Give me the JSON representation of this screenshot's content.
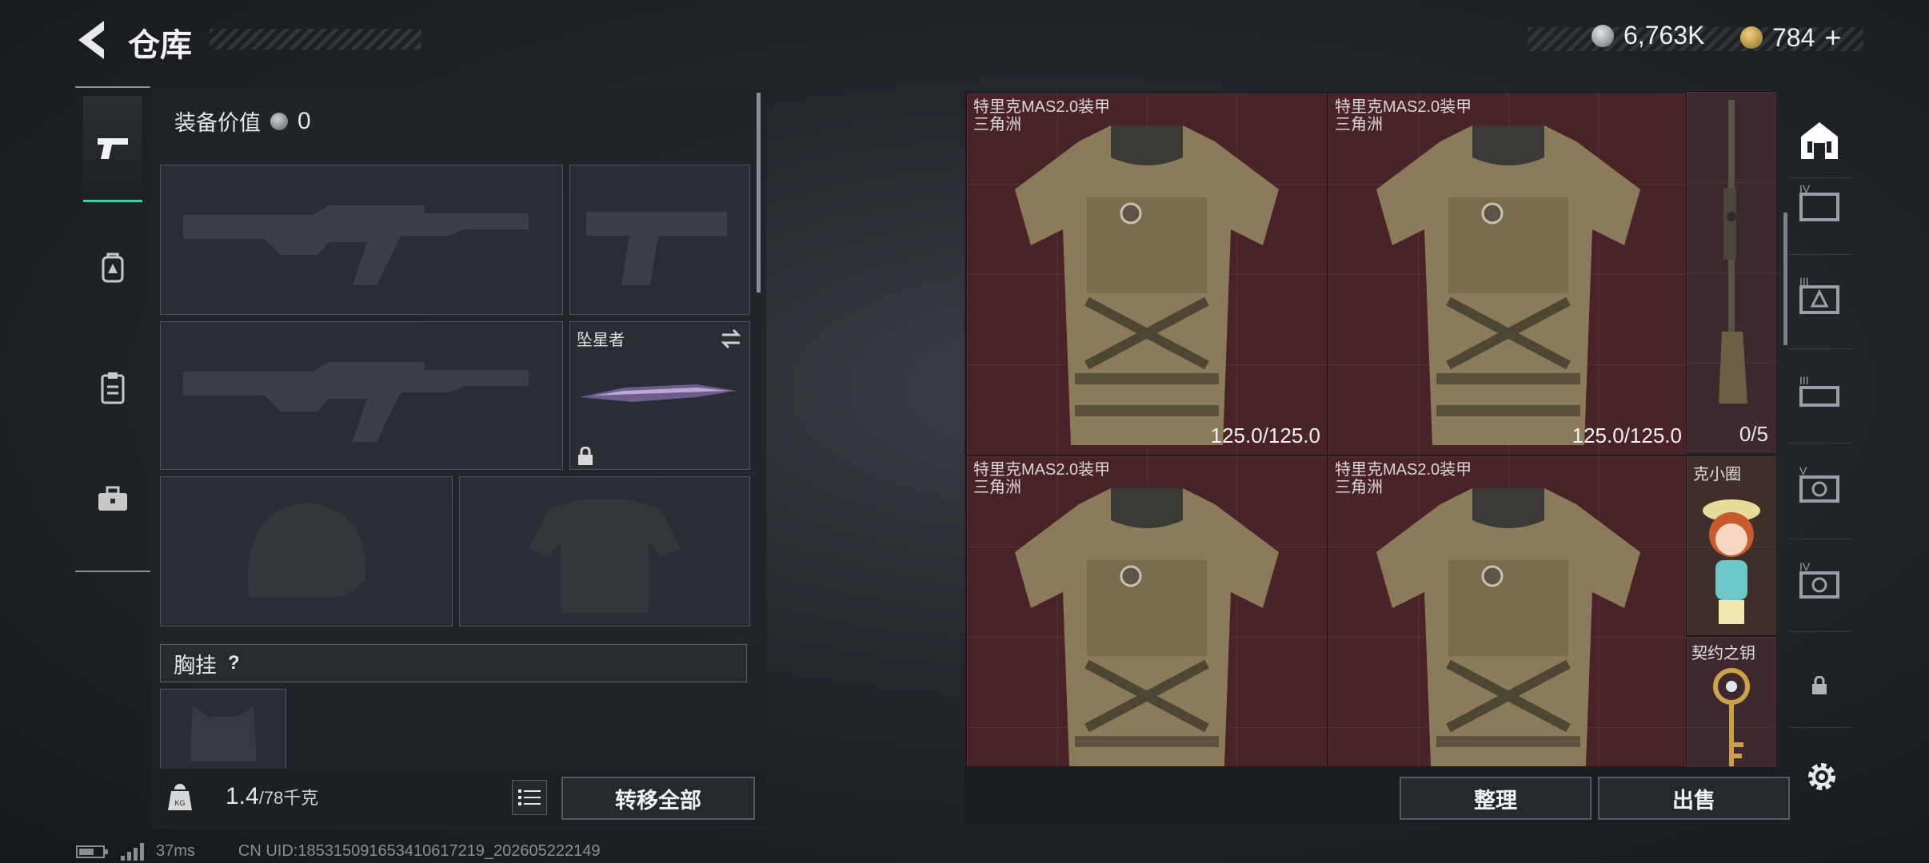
{
  "header": {
    "title": "仓库",
    "currency_1": {
      "value": "6,763K",
      "icon": "silver-coin-icon"
    },
    "currency_2": {
      "value": "784",
      "plus": "+",
      "icon": "gold-triangle-coin-icon"
    }
  },
  "left_tabs": [
    {
      "name": "weapon-tab",
      "icon": "pistol-icon",
      "active": true
    },
    {
      "name": "gear-tab",
      "icon": "backpack-icon",
      "active": false
    },
    {
      "name": "clipboard-tab",
      "icon": "clipboard-icon",
      "active": false
    },
    {
      "name": "toolbox-tab",
      "icon": "toolbox-icon",
      "active": false
    }
  ],
  "equipment": {
    "value_label": "装备价值",
    "value": "0",
    "melee_name": "坠星者",
    "chest_rig_label": "胸挂",
    "chest_rig_help": "?",
    "weight_current": "1.4",
    "weight_max": "/78千克",
    "transfer_all": "转移全部"
  },
  "stash": {
    "armor_items": [
      {
        "name": "特里克MAS2.0装甲",
        "sub": "三角洲",
        "durability": "125.0/125.0",
        "show_dur": true
      },
      {
        "name": "特里克MAS2.0装甲",
        "sub": "三角洲",
        "durability": "125.0/125.0",
        "show_dur": true
      },
      {
        "name": "特里克MAS2.0装甲",
        "sub": "三角洲",
        "durability": "",
        "show_dur": false
      },
      {
        "name": "特里克MAS2.0装甲",
        "sub": "三角洲",
        "durability": "",
        "show_dur": false
      }
    ],
    "rifle_count": "0/5",
    "figure_name": "克小圈",
    "key_name": "契约之钥",
    "organize_button": "整理",
    "sell_button": "出售"
  },
  "right_tabs": [
    {
      "icon": "home-icon",
      "label": ""
    },
    {
      "icon": "case-icon",
      "label": "IV"
    },
    {
      "icon": "case-icon",
      "label": "III"
    },
    {
      "icon": "case-icon",
      "label": "III"
    },
    {
      "icon": "case-icon",
      "label": "V"
    },
    {
      "icon": "case-icon",
      "label": "IV"
    },
    {
      "icon": "lock-icon",
      "label": ""
    },
    {
      "icon": "gear-icon",
      "label": ""
    }
  ],
  "status": {
    "latency": "37ms",
    "uid": "CN UID:1853150916534106​17219_202605222149"
  },
  "colors": {
    "accent": "#36d39b",
    "armor_bg": "#4a2328",
    "panel": "#202429"
  }
}
